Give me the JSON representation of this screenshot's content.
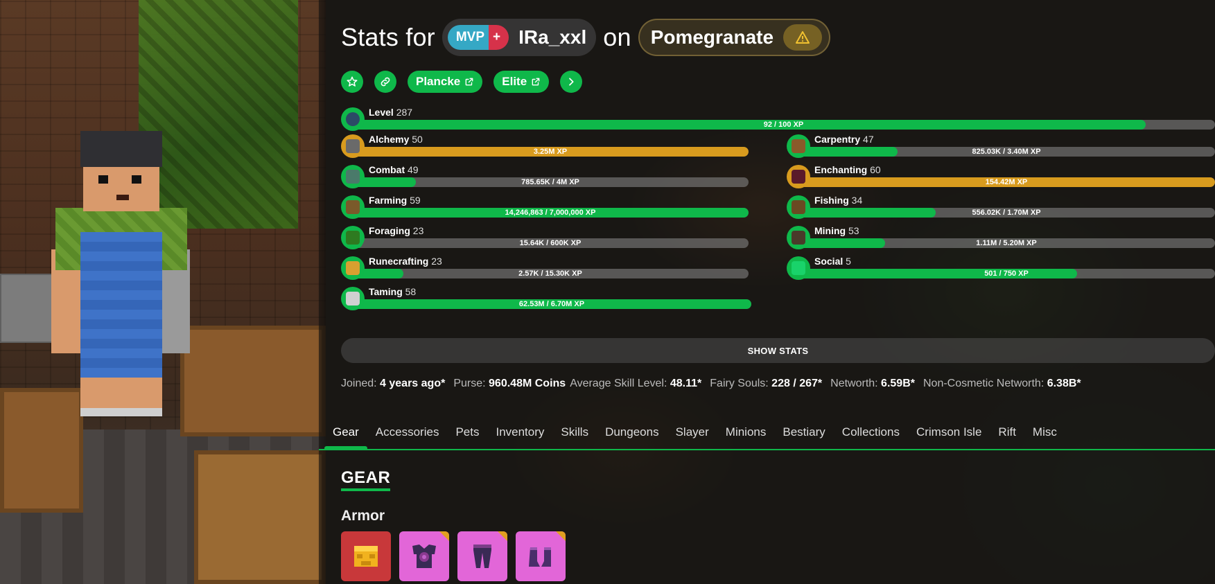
{
  "header": {
    "prefix": "Stats for",
    "rank_mvp": "MVP",
    "rank_plus": "+",
    "player_name": "IRa_xxl",
    "connector": "on",
    "profile_name": "Pomegranate"
  },
  "links": {
    "plancke": "Plancke",
    "elite": "Elite"
  },
  "level": {
    "name": "Level",
    "value": "287",
    "xp": "92 / 100 XP",
    "progress": 0.92
  },
  "skills_left": [
    {
      "name": "Alchemy",
      "value": "50",
      "xp": "3.25M XP",
      "progress": 1.0,
      "maxed": true,
      "icon": "brewing-stand-icon"
    },
    {
      "name": "Combat",
      "value": "49",
      "xp": "785.65K / 4M XP",
      "progress": 0.16,
      "maxed": false,
      "icon": "sword-icon"
    },
    {
      "name": "Farming",
      "value": "59",
      "xp": "14,246,863 / 7,000,000 XP",
      "progress": 1.0,
      "maxed": false,
      "icon": "hoe-icon"
    },
    {
      "name": "Foraging",
      "value": "23",
      "xp": "15.64K / 600K XP",
      "progress": 0.026,
      "maxed": false,
      "icon": "sapling-icon"
    },
    {
      "name": "Runecrafting",
      "value": "23",
      "xp": "2.57K / 15.30K XP",
      "progress": 0.13,
      "maxed": false,
      "icon": "magma-cream-icon"
    },
    {
      "name": "Taming",
      "value": "58",
      "xp": "62.53M / 6.70M XP",
      "progress": 1.0,
      "maxed": false,
      "icon": "spawn-egg-icon"
    }
  ],
  "skills_right": [
    {
      "name": "Carpentry",
      "value": "47",
      "xp": "825.03K / 3.40M XP",
      "progress": 0.24,
      "maxed": false,
      "icon": "crafting-table-icon"
    },
    {
      "name": "Enchanting",
      "value": "60",
      "xp": "154.42M XP",
      "progress": 1.0,
      "maxed": true,
      "icon": "enchanting-table-icon"
    },
    {
      "name": "Fishing",
      "value": "34",
      "xp": "556.02K / 1.70M XP",
      "progress": 0.33,
      "maxed": false,
      "icon": "fishing-rod-icon"
    },
    {
      "name": "Mining",
      "value": "53",
      "xp": "1.11M / 5.20M XP",
      "progress": 0.21,
      "maxed": false,
      "icon": "pickaxe-icon"
    },
    {
      "name": "Social",
      "value": "5",
      "xp": "501 / 750 XP",
      "progress": 0.67,
      "maxed": false,
      "icon": "emerald-icon"
    }
  ],
  "show_stats": "SHOW STATS",
  "summary": [
    {
      "key": "Joined:",
      "value": "4 years ago",
      "star": "*"
    },
    {
      "key": "Purse:",
      "value": "960.48M Coins",
      "star": ""
    },
    {
      "key": "Average Skill Level:",
      "value": "48.11",
      "star": "*"
    },
    {
      "key": "Fairy Souls:",
      "value": "228 / 267",
      "star": "*"
    },
    {
      "key": "Networth:",
      "value": "6.59B",
      "star": "*"
    },
    {
      "key": "Non-Cosmetic Networth:",
      "value": "6.38B",
      "star": "*"
    }
  ],
  "tabs": [
    "Gear",
    "Accessories",
    "Pets",
    "Inventory",
    "Skills",
    "Dungeons",
    "Slayer",
    "Minions",
    "Bestiary",
    "Collections",
    "Crimson Isle",
    "Rift",
    "Misc"
  ],
  "active_tab": "Gear",
  "section_title": "GEAR",
  "armor_title": "Armor",
  "colors": {
    "accent": "#0fb84a",
    "maxed": "#d89b1e",
    "rank_mvp": "#35a8c5",
    "rank_plus": "#d6324a"
  }
}
